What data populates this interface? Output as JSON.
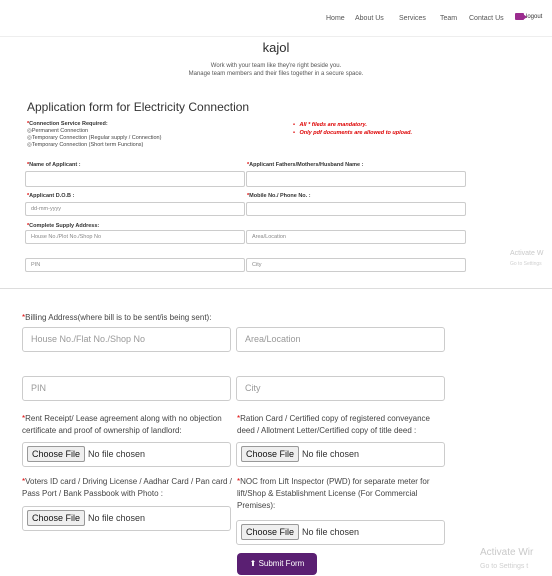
{
  "nav": {
    "items": [
      "Home",
      "About Us",
      "Services",
      "Team",
      "Contact Us"
    ],
    "logout": "logout"
  },
  "brand": "kajol",
  "tagline": [
    "Work with your team like they're right beside you.",
    "Manage team members and their files together in a secure space."
  ],
  "form_title": "Application form for Electricity Connection",
  "connection": {
    "label": "Connection Service Required:",
    "options": [
      "Permanent Connection",
      "Temporary Connection (Regular supply / Connection)",
      "Temporary Connection (Short term Functions)"
    ]
  },
  "notes": [
    "All * fileds are mandatory.",
    "Only pdf documents are allowed to upload."
  ],
  "top_section": {
    "name_label": "Name of Applicant :",
    "father_label": "Applicant Fathers/Mothers/Husband Name :",
    "dob_label": "Applicant D.O.B :",
    "dob_placeholder": "dd-mm-yyyy",
    "mobile_label": "Mobile No./ Phone No. :",
    "address_label": "Complete Supply Address:",
    "house_placeholder": "House No./Plot No./Shop No",
    "area_placeholder": "Area/Location",
    "pin_placeholder": "PIN",
    "city_placeholder": "City"
  },
  "bottom_section": {
    "billing_label": "Billing Address(where bill is to be sent/is being sent):",
    "house_placeholder": "House No./Flat No./Shop No",
    "area_placeholder": "Area/Location",
    "pin_placeholder": "PIN",
    "city_placeholder": "City",
    "rent_label_1": "Rent Receipt/ Lease agreement along with no objection",
    "rent_label_2": "certificate and proof of ownership of landlord:",
    "ration_label_1": "Ration Card / Certified copy of registered conveyance",
    "ration_label_2": "deed / Allotment Letter/Certified copy of title deed :",
    "voters_label_1": "Voters ID card / Driving License / Aadhar Card / Pan card /",
    "voters_label_2": "Pass Port / Bank Passbook with Photo :",
    "noc_label_1": "NOC from Lift Inspector (PWD) for separate meter for",
    "noc_label_2": "lift/Shop & Establishment License (For Commercial",
    "noc_label_3": "Premises):",
    "choose_file": "Choose File",
    "no_file": "No file chosen"
  },
  "submit": "Submit Form",
  "watermark": {
    "title": "Activate W",
    "title2": "Activate Wir",
    "sub": "Go to Settings",
    "sub2": "Go to Settings t"
  }
}
